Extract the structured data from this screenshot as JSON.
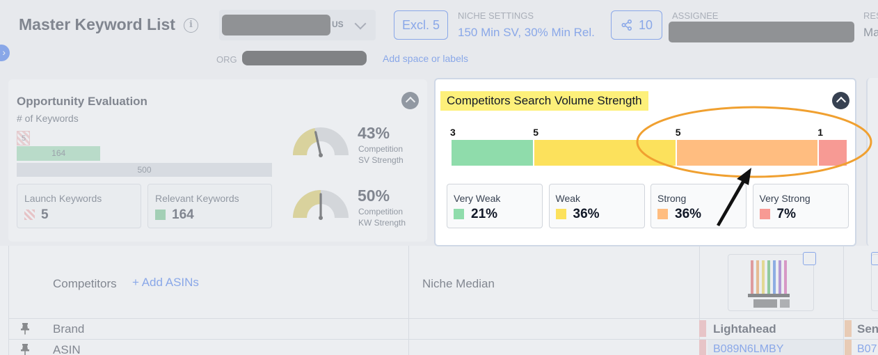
{
  "header": {
    "title": "Master Keyword List",
    "market_code": "US",
    "excl_label": "Excl. 5",
    "niche_settings_label": "NICHE SETTINGS",
    "niche_settings_value": "150 Min SV, 30% Min Rel.",
    "share_count": "10",
    "assignee_label": "ASSIGNEE",
    "res_label": "RES",
    "res_value": "Ma",
    "org_label": "ORG",
    "add_labels_link": "Add space or labels"
  },
  "opportunity": {
    "title": "Opportunity Evaluation",
    "subtitle": "# of Keywords",
    "bars": {
      "launch": 5,
      "relevant": 164,
      "total": 500
    },
    "launch_label": "Launch Keywords",
    "launch_value": "5",
    "relevant_label": "Relevant Keywords",
    "relevant_value": "164",
    "gauges": [
      {
        "pct_text": "43%",
        "value": 0.43,
        "caption1": "Competition",
        "caption2": "SV Strength"
      },
      {
        "pct_text": "50%",
        "value": 0.5,
        "caption1": "Competition",
        "caption2": "KW Strength"
      }
    ]
  },
  "competitors_strength": {
    "title": "Competitors Search Volume Strength",
    "segments": [
      {
        "name": "Very Weak",
        "count": "3",
        "pct_text": "21%",
        "pct": 21,
        "color": "#8fdcab"
      },
      {
        "name": "Weak",
        "count": "5",
        "pct_text": "36%",
        "pct": 36,
        "color": "#fce15c"
      },
      {
        "name": "Strong",
        "count": "5",
        "pct_text": "36%",
        "pct": 36,
        "color": "#ffbd80"
      },
      {
        "name": "Very Strong",
        "count": "1",
        "pct_text": "7%",
        "pct": 7,
        "color": "#f79a94"
      }
    ]
  },
  "table": {
    "competitors_label": "Competitors",
    "add_asins_label": "+ Add ASINs",
    "niche_median_label": "Niche Median",
    "rows": [
      "Brand",
      "ASIN"
    ],
    "products": [
      {
        "brand": "Lightahead",
        "asin": "B089N6LMBY",
        "color": "#f4a3a3"
      },
      {
        "brand": "Sen",
        "asin": "B07",
        "color": "#f5b27a"
      }
    ]
  },
  "colors": {
    "accent": "#2563eb",
    "highlight": "#fdf07a",
    "annotation": "#f0a030"
  }
}
